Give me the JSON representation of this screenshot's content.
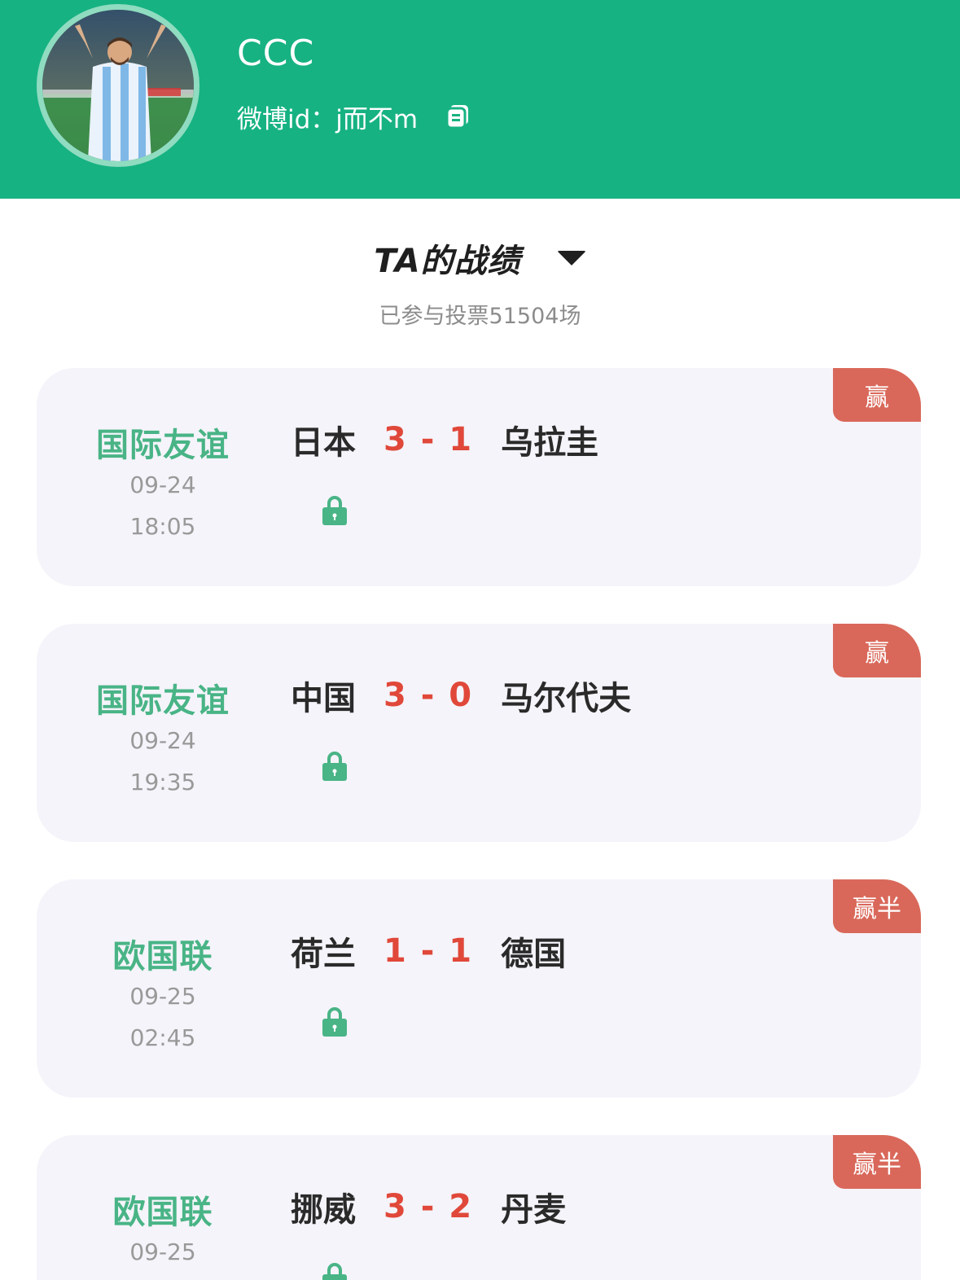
{
  "profile": {
    "username": "CCC",
    "weibo_label": "微博id：",
    "weibo_id": "j而不m",
    "copy_icon": "copy-icon",
    "avatar": "player-photo"
  },
  "colors": {
    "header_bg": "#17b282",
    "league": "#49b486",
    "score": "#e0483a",
    "badge": "#d9685a",
    "card_bg": "#f5f4fa"
  },
  "section": {
    "title": "TA的战绩",
    "dropdown_icon": "caret-down-icon",
    "subtitle": "已参与投票51504场"
  },
  "matches": [
    {
      "league": "国际友谊",
      "date": "09-24",
      "time": "18:05",
      "home": "日本",
      "score": "3 - 1",
      "away": "乌拉圭",
      "result": "赢",
      "lock_icon": "lock-icon"
    },
    {
      "league": "国际友谊",
      "date": "09-24",
      "time": "19:35",
      "home": "中国",
      "score": "3 - 0",
      "away": "马尔代夫",
      "result": "赢",
      "lock_icon": "lock-icon"
    },
    {
      "league": "欧国联",
      "date": "09-25",
      "time": "02:45",
      "home": "荷兰",
      "score": "1 - 1",
      "away": "德国",
      "result": "赢半",
      "lock_icon": "lock-icon"
    },
    {
      "league": "欧国联",
      "date": "09-25",
      "time": "",
      "home": "挪威",
      "score": "3 - 2",
      "away": "丹麦",
      "result": "赢半",
      "lock_icon": "lock-icon"
    }
  ]
}
